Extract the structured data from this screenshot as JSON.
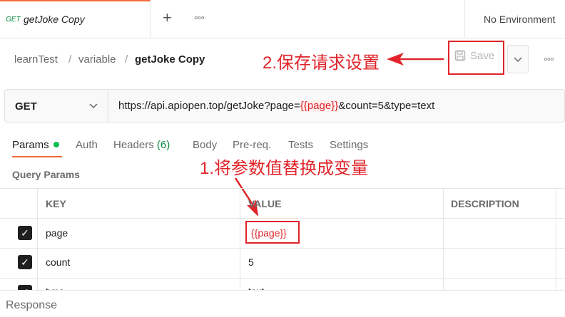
{
  "tab": {
    "method": "GET",
    "title": "getJoke Copy"
  },
  "environment": "No Environment",
  "breadcrumb": {
    "root": "learnTest",
    "sep": "/",
    "folder": "variable",
    "current": "getJoke Copy"
  },
  "save": {
    "label": "Save"
  },
  "request": {
    "method": "GET",
    "url_prefix": "https://api.apiopen.top/getJoke?page=",
    "url_var": "{{page}}",
    "url_suffix": "&count=5&type=text"
  },
  "request_tabs": {
    "params": "Params",
    "auth": "Auth",
    "headers": "Headers",
    "headers_count": "(6)",
    "body": "Body",
    "prereq": "Pre-req.",
    "tests": "Tests",
    "settings": "Settings"
  },
  "query_params_title": "Query Params",
  "table": {
    "headers": {
      "key": "KEY",
      "value": "VALUE",
      "description": "DESCRIPTION"
    },
    "rows": [
      {
        "key": "page",
        "value": "{{page}}",
        "description": ""
      },
      {
        "key": "count",
        "value": "5",
        "description": ""
      },
      {
        "key": "type",
        "value": "text",
        "description": ""
      }
    ]
  },
  "response_label": "Response",
  "annotations": {
    "step1": "1.将参数值替换成变量",
    "step2": "2.保存请求设置"
  },
  "colors": {
    "accent": "#f26b3a",
    "annotation": "#e0242a",
    "get": "#0a8a3f"
  }
}
